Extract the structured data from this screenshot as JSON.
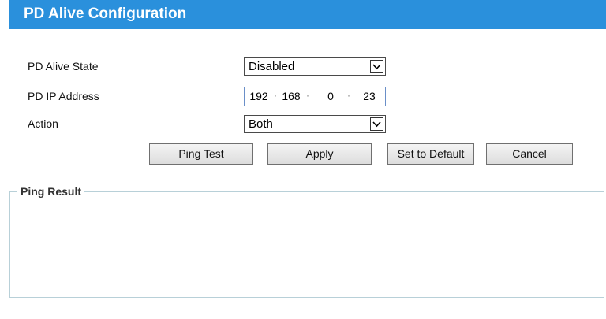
{
  "header": {
    "title": "PD Alive Configuration"
  },
  "form": {
    "state": {
      "label": "PD Alive State",
      "value": "Disabled"
    },
    "ip": {
      "label": "PD IP Address",
      "octets": [
        "192",
        "168",
        "0",
        "23"
      ]
    },
    "action": {
      "label": "Action",
      "value": "Both"
    }
  },
  "buttons": {
    "ping_test": "Ping Test",
    "apply": "Apply",
    "set_default": "Set to Default",
    "cancel": "Cancel"
  },
  "ping_result": {
    "legend": "Ping Result",
    "text": ""
  },
  "colors": {
    "header_bg": "#2a90dc",
    "header_text": "#ffffff",
    "ip_border": "#6a8fc8"
  },
  "icons": {
    "dropdown": "chevron-down-icon"
  }
}
